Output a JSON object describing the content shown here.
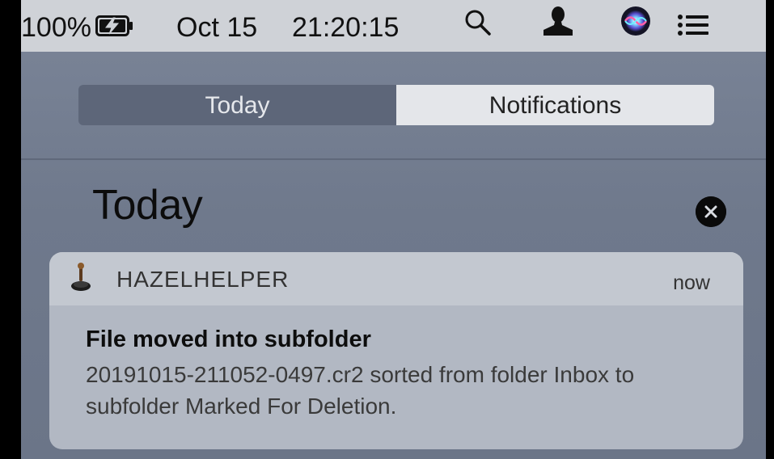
{
  "menubar": {
    "battery_percent": "100%",
    "date": "Oct 15",
    "time": "21:20:15",
    "icons": [
      "battery-charging-icon",
      "search-icon",
      "user-icon",
      "siri-icon",
      "notification-center-icon"
    ]
  },
  "tabs": {
    "today": "Today",
    "notifications": "Notifications",
    "selected": "Notifications"
  },
  "section": {
    "title": "Today"
  },
  "notification": {
    "app": "HAZELHELPER",
    "time": "now",
    "title": "File moved into subfolder",
    "body": "20191015-211052-0497.cr2 sorted from folder Inbox to subfolder Marked For Deletion."
  },
  "colors": {
    "menubar": "#cfd2d7",
    "panel": "#788295",
    "card": "#b2b8c3",
    "selected_tab": "#e4e6ea"
  }
}
